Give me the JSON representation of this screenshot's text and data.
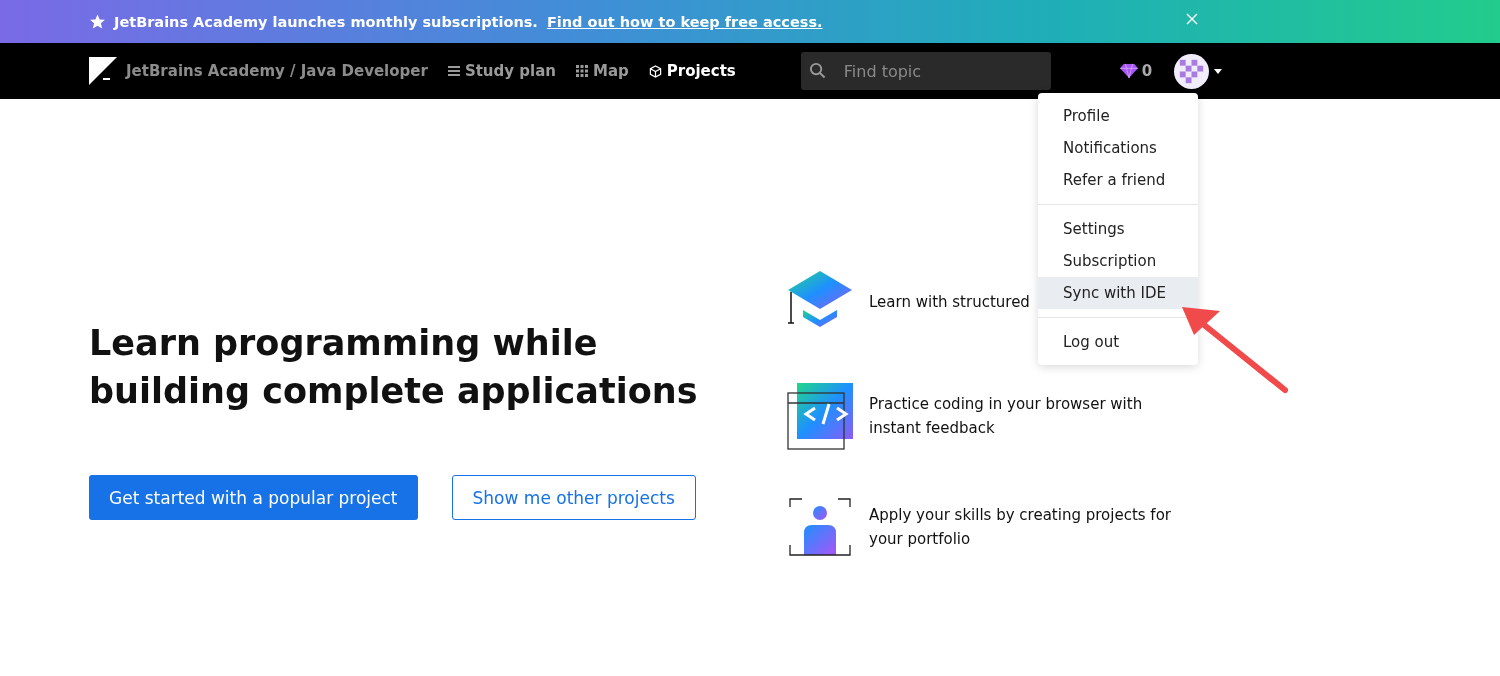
{
  "banner": {
    "text": "JetBrains Academy launches monthly subscriptions.",
    "link": "Find out how to keep free access."
  },
  "nav": {
    "brand": "JetBrains Academy / Java Developer",
    "links": [
      {
        "label": "Study plan",
        "selected": false
      },
      {
        "label": "Map",
        "selected": false
      },
      {
        "label": "Projects",
        "selected": true
      }
    ],
    "search": {
      "placeholder": "Find topic"
    },
    "gems": "0"
  },
  "menu": {
    "groups": [
      [
        {
          "label": "Profile",
          "selected": false
        },
        {
          "label": "Notifications",
          "selected": false
        },
        {
          "label": "Refer a friend",
          "selected": false
        }
      ],
      [
        {
          "label": "Settings",
          "selected": false
        },
        {
          "label": "Subscription",
          "selected": false
        },
        {
          "label": "Sync with IDE",
          "selected": true
        }
      ],
      [
        {
          "label": "Log out",
          "selected": false
        }
      ]
    ]
  },
  "hero": {
    "title": "Learn programming while building complete applications",
    "primary_button": "Get started with a popular project",
    "secondary_button": "Show me other projects"
  },
  "features": [
    {
      "kind": "cap",
      "text": "Learn with structured"
    },
    {
      "kind": "code",
      "text": "Practice coding in your browser with instant feedback"
    },
    {
      "kind": "person",
      "text": "Apply your skills by creating projects for your portfolio"
    }
  ]
}
